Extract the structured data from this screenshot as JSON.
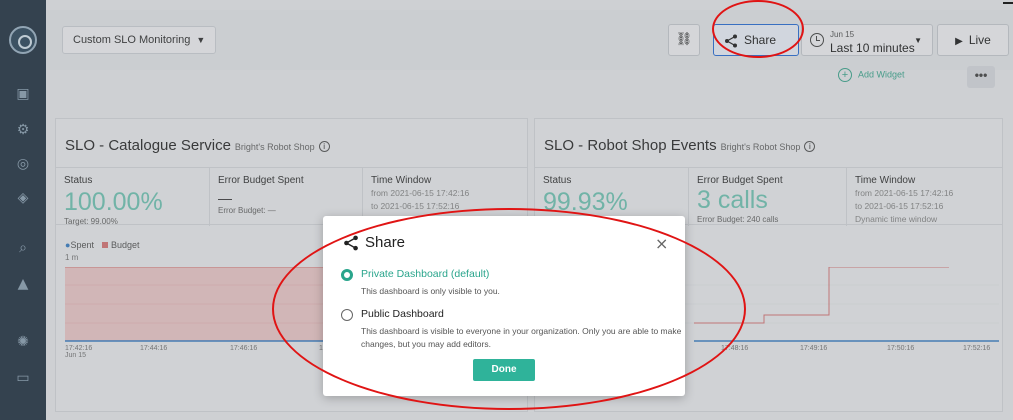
{
  "topbar": {
    "dashboard_title": "Custom SLO Monitoring",
    "share_label": "Share",
    "time_date": "Jun 15",
    "time_range": "Last 10 minutes",
    "live_label": "Live",
    "add_widget_label": "Add Widget",
    "more_label": "•••"
  },
  "widgets": [
    {
      "title": "SLO - Catalogue Service",
      "subtitle": "Bright's Robot Shop",
      "status_label": "Status",
      "status_value": "100.00%",
      "status_target": "Target: 99.00%",
      "budget_label": "Error Budget Spent",
      "budget_value": "—",
      "budget_note": "Error Budget: —",
      "time_label": "Time Window",
      "time_from": "from 2021-06-15 17:42:16",
      "time_to": "to 2021-06-15 17:52:16",
      "legend_spent": "Spent",
      "legend_budget": "Budget",
      "y_unit": "1 m",
      "x_ticks": [
        "17:42:16",
        "17:44:16",
        "17:46:16",
        "17"
      ],
      "x_sub": "Jun 15"
    },
    {
      "title": "SLO - Robot Shop Events",
      "subtitle": "Bright's Robot Shop",
      "status_label": "Status",
      "status_value": "99.93%",
      "budget_label": "Error Budget Spent",
      "budget_value": "3 calls",
      "budget_note": "Error Budget:  240 calls",
      "time_label": "Time Window",
      "time_from": "from 2021-06-15 17:42:16",
      "time_to": "to 2021-06-15 17:52:16",
      "time_note": "Dynamic time window",
      "x_ticks": [
        "17:48:16",
        "17:49:16",
        "17:50:16",
        "17:52:16"
      ]
    }
  ],
  "modal": {
    "title": "Share",
    "close": "×",
    "options": [
      {
        "title": "Private Dashboard (default)",
        "desc": "This dashboard is only visible to you.",
        "selected": true
      },
      {
        "title": "Public Dashboard",
        "desc": "This dashboard is visible to everyone in your organization. Only you are able to make changes, but you may add editors.",
        "selected": false
      }
    ],
    "done_label": "Done"
  },
  "colors": {
    "accent": "#2fb39a",
    "sidebar": "#243545",
    "budget": "#d87777",
    "annotation": "#e01414"
  }
}
